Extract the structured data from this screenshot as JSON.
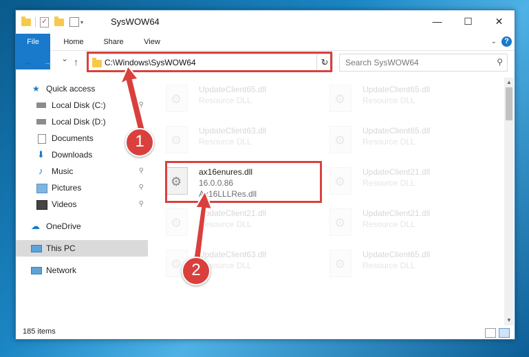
{
  "window": {
    "title": "SysWOW64",
    "minimize": "—",
    "maximize": "☐",
    "close": "✕"
  },
  "ribbon": {
    "tabs": [
      "File",
      "Home",
      "Share",
      "View"
    ],
    "help": "?"
  },
  "navbar": {
    "back": "←",
    "forward": "→",
    "recent": "⌄",
    "up": "↑"
  },
  "address": {
    "path": "C:\\Windows\\SysWOW64",
    "dropdown": "⌄",
    "refresh": "↻"
  },
  "search": {
    "placeholder": "Search SysWOW64",
    "icon": "search-icon"
  },
  "sidebar": {
    "items": [
      {
        "label": "Quick access",
        "icon": "star-icon"
      },
      {
        "label": "Local Disk (C:)",
        "icon": "drive-icon"
      },
      {
        "label": "Local Disk (D:)",
        "icon": "drive-icon"
      },
      {
        "label": "Documents",
        "icon": "documents-icon"
      },
      {
        "label": "Downloads",
        "icon": "download-icon"
      },
      {
        "label": "Music",
        "icon": "music-icon"
      },
      {
        "label": "Pictures",
        "icon": "pictures-icon"
      },
      {
        "label": "Videos",
        "icon": "videos-icon"
      },
      {
        "label": "OneDrive",
        "icon": "cloud-icon"
      },
      {
        "label": "This PC",
        "icon": "computer-icon"
      },
      {
        "label": "Network",
        "icon": "network-icon"
      }
    ],
    "pin": "📌"
  },
  "files": [
    {
      "name": "UpdateClient65.dll",
      "sub": "Resource DLL"
    },
    {
      "name": "UpdateClient65.dll",
      "sub": "Resource DLL"
    },
    {
      "name": "UpdateClient63.dll",
      "sub": "Resource DLL"
    },
    {
      "name": "UpdateClient65.dll",
      "sub": "Resource DLL"
    },
    {
      "name": "ax16enures.dll",
      "sub": "16.0.0.86",
      "sub2": "Ax16LLLRes.dll"
    },
    {
      "name": "UpdateClient21.dll",
      "sub": "Resource DLL"
    },
    {
      "name": "UpdateClient21.dll",
      "sub": "Resource DLL"
    },
    {
      "name": "UpdateClient21.dll",
      "sub": "Resource DLL"
    },
    {
      "name": "UpdateClient63.dll",
      "sub": "Resource DLL"
    },
    {
      "name": "UpdateClient65.dll",
      "sub": "Resource DLL"
    }
  ],
  "status": {
    "items": "185 items"
  },
  "annotations": {
    "step1": "1",
    "step2": "2",
    "highlight_color": "#d9403d"
  }
}
